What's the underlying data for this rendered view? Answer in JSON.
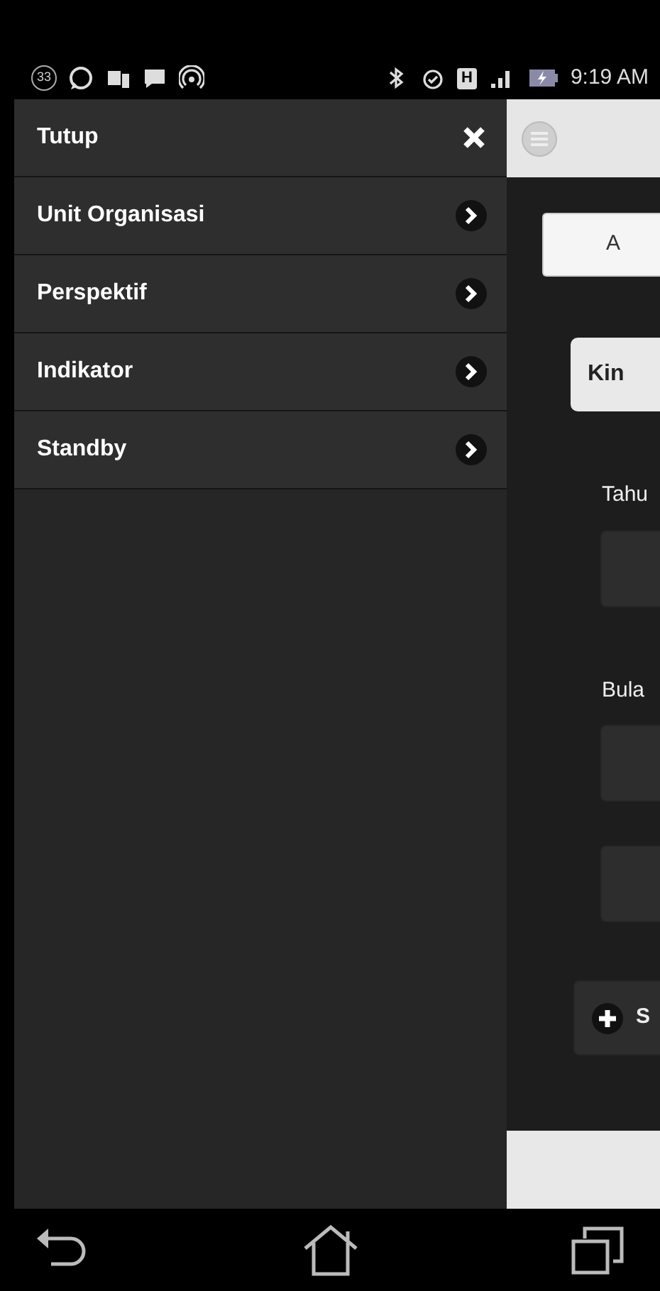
{
  "status_bar": {
    "notification_count": "33",
    "network": "H",
    "time": "9:19 AM"
  },
  "drawer": {
    "close_label": "Tutup",
    "items": [
      {
        "label": "Unit Organisasi"
      },
      {
        "label": "Perspektif"
      },
      {
        "label": "Indikator"
      },
      {
        "label": "Standby"
      }
    ]
  },
  "page": {
    "content": [
      {
        "kind": "tab-button",
        "label": "A"
      },
      {
        "kind": "button",
        "label": "Kin"
      },
      {
        "kind": "label",
        "label": "Tahu"
      },
      {
        "kind": "field"
      },
      {
        "kind": "label",
        "label": "Bula"
      },
      {
        "kind": "field"
      },
      {
        "kind": "field"
      },
      {
        "kind": "add-button",
        "label": "S"
      }
    ]
  }
}
